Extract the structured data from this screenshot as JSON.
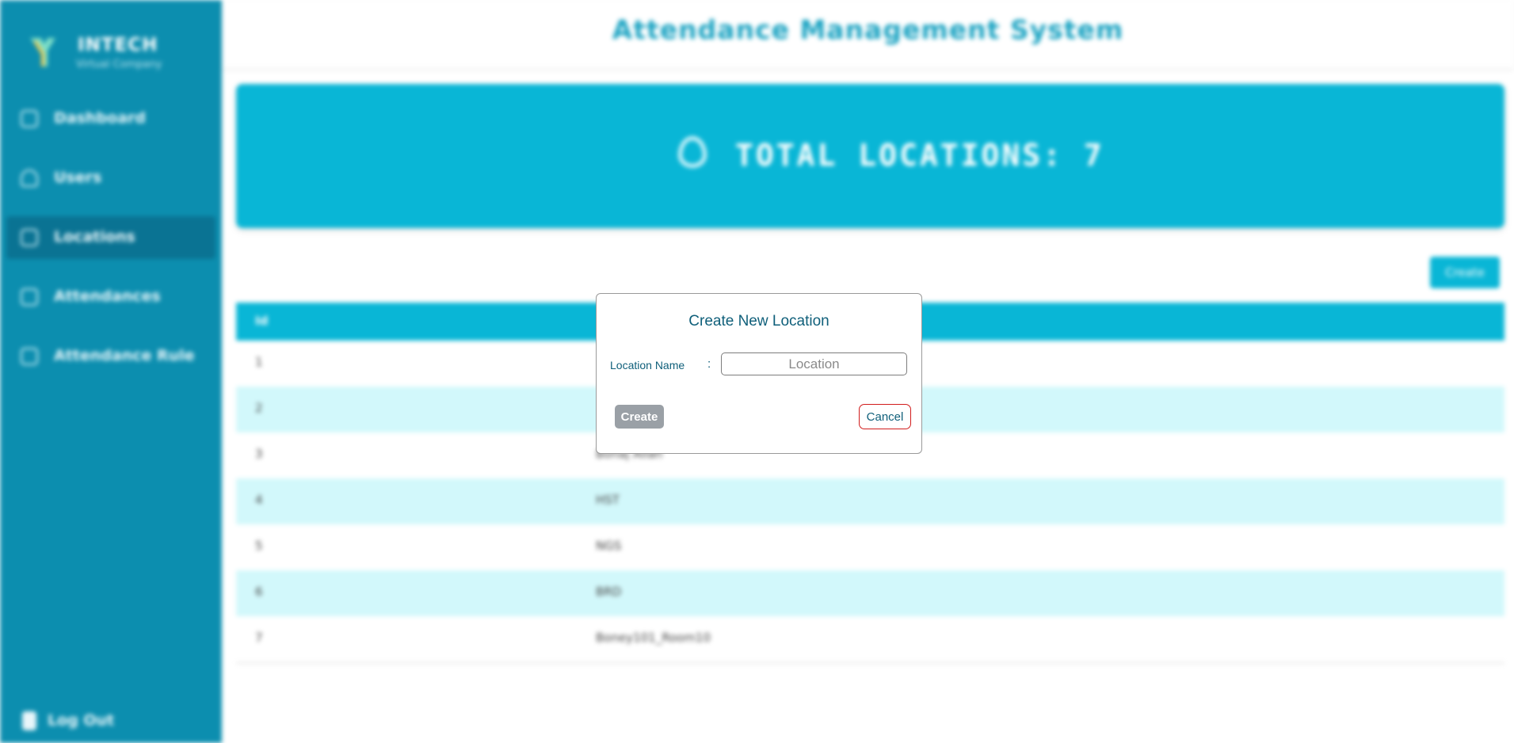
{
  "sidebar": {
    "logo": {
      "name": "INTECH",
      "subtitle": "Virtual Company"
    },
    "items": [
      {
        "label": "Dashboard",
        "icon": "dashboard-icon",
        "active": false
      },
      {
        "label": "Users",
        "icon": "user-icon",
        "active": false
      },
      {
        "label": "Locations",
        "icon": "location-icon",
        "active": true
      },
      {
        "label": "Attendances",
        "icon": "attendance-icon",
        "active": false
      },
      {
        "label": "Attendance Rule",
        "icon": "rule-icon",
        "active": false
      }
    ],
    "logout_label": "Log Out"
  },
  "header": {
    "title": "Attendance Management System"
  },
  "banner": {
    "text": "TOTAL LOCATIONS: 7",
    "icon": "location-pin-icon"
  },
  "toolbar": {
    "create_label": "Create"
  },
  "table": {
    "columns": [
      "Id",
      ""
    ],
    "rows": [
      {
        "id": "1",
        "name": ""
      },
      {
        "id": "2",
        "name": ""
      },
      {
        "id": "3",
        "name": "Bonaj Allah"
      },
      {
        "id": "4",
        "name": "HST"
      },
      {
        "id": "5",
        "name": "NGS"
      },
      {
        "id": "6",
        "name": "BRD"
      },
      {
        "id": "7",
        "name": "Boney101_Room10"
      }
    ]
  },
  "modal": {
    "title": "Create New Location",
    "field_label": "Location Name",
    "separator": ":",
    "input_value": "",
    "input_placeholder": "Location",
    "create_label": "Create",
    "cancel_label": "Cancel"
  },
  "colors": {
    "sidebar_bg": "#0c8eaf",
    "accent": "#09b6d6",
    "row_alt": "#d2f8fb",
    "cancel_border": "#d11c1c",
    "create_disabled": "#9aa0a6"
  }
}
